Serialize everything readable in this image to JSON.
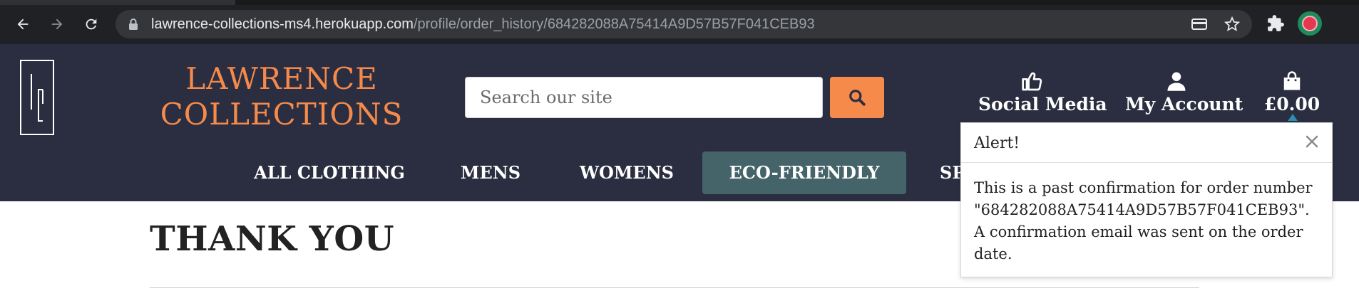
{
  "browser": {
    "url_host": "lawrence-collections-ms4.herokuapp.com",
    "url_path": "/profile/order_history/684282088A75414A9D57B57F041CEB93",
    "icons": [
      "back-icon",
      "forward-icon",
      "reload-icon",
      "lock-icon",
      "card-icon",
      "star-icon",
      "extensions-icon",
      "profile-avatar"
    ]
  },
  "header": {
    "brand_line1": "LAWRENCE",
    "brand_line2": "COLLECTIONS",
    "search_placeholder": "Search our site",
    "links": {
      "social": "Social Media",
      "account": "My Account",
      "cart": "£0.00"
    }
  },
  "nav": {
    "items": [
      "ALL CLOTHING",
      "MENS",
      "WOMENS",
      "ECO-FRIENDLY",
      "SP"
    ],
    "active": "ECO-FRIENDLY"
  },
  "main": {
    "title": "THANK YOU"
  },
  "toast": {
    "title": "Alert!",
    "message": "This is a past confirmation for order number \"684282088A75414A9D57B57F041CEB93\". A confirmation email was sent on the order date."
  },
  "colors": {
    "header_bg": "#2b2e40",
    "accent_orange": "#f58a4b",
    "nav_active": "#456469",
    "toast_accent": "#2a8fb0"
  }
}
